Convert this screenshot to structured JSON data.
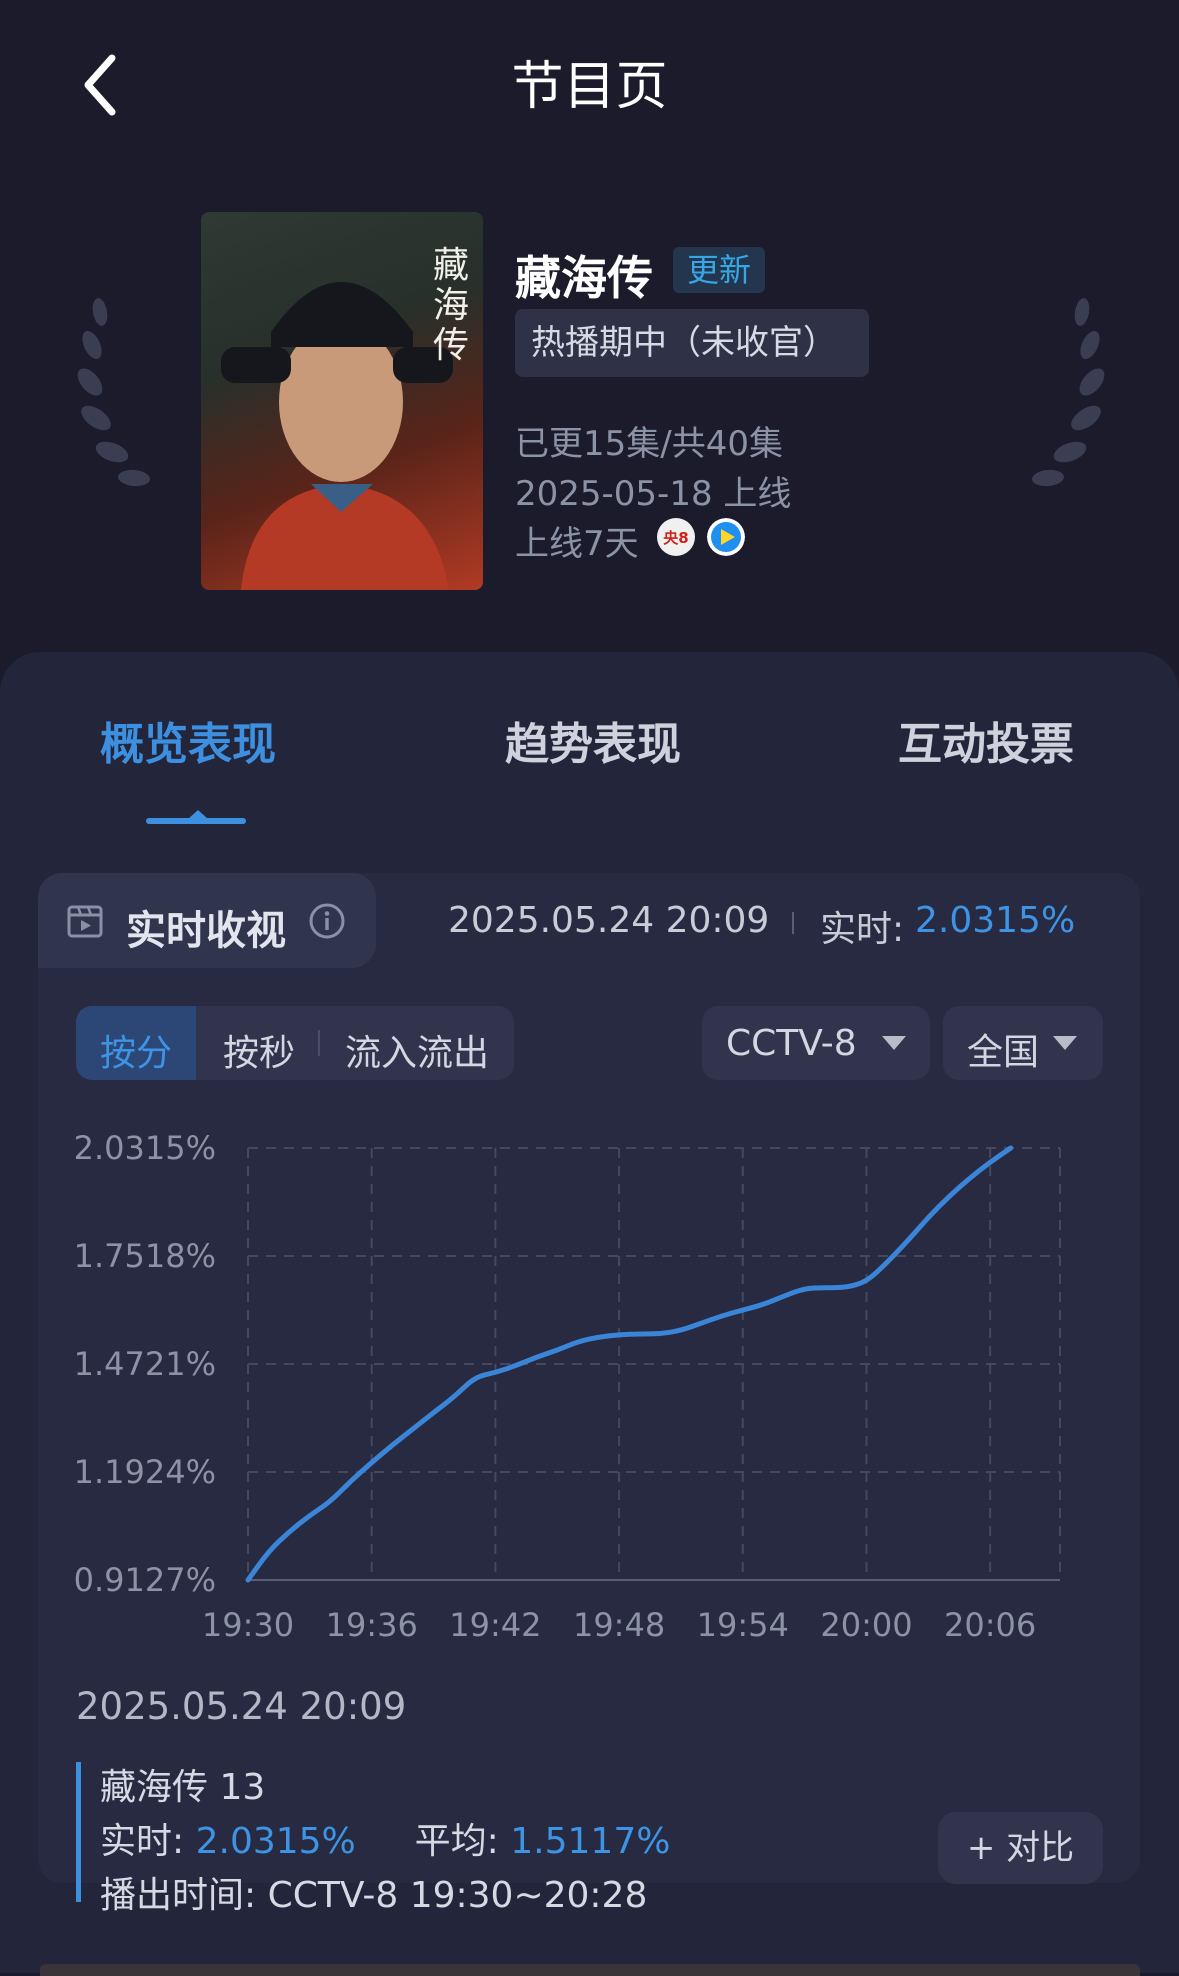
{
  "header": {
    "title": "节目页",
    "back_icon": "chevron-left-icon"
  },
  "show": {
    "title": "藏海传",
    "update_badge": "更新",
    "status": "热播期中（未收官）",
    "episodes": "已更15集/共40集",
    "release": "2025-05-18 上线",
    "days_online": "上线7天",
    "channel_icons": [
      "cctv8-icon",
      "play-platform-icon"
    ],
    "cctv8_icon_text": "央8",
    "poster_text": "藏海传"
  },
  "tabs": [
    {
      "label": "概览表现",
      "active": true
    },
    {
      "label": "趋势表现",
      "active": false
    },
    {
      "label": "互动投票",
      "active": false
    }
  ],
  "realtime": {
    "label": "实时收视",
    "timestamp": "2025.05.24 20:09",
    "rt_label": "实时:",
    "rt_value": "2.0315%"
  },
  "segments": [
    {
      "label": "按分",
      "active": true
    },
    {
      "label": "按秒",
      "active": false
    },
    {
      "label": "流入流出",
      "active": false
    }
  ],
  "filters": {
    "channel": "CCTV-8",
    "region": "全国"
  },
  "colors": {
    "accent": "#3e94e4",
    "background": "#1b1b2b",
    "card": "#23253a"
  },
  "chart_data": {
    "type": "line",
    "x_ticks": [
      "19:30",
      "19:36",
      "19:42",
      "19:48",
      "19:54",
      "20:00",
      "20:06"
    ],
    "y_ticks": [
      "0.9127%",
      "1.1924%",
      "1.4721%",
      "1.7518%",
      "2.0315%"
    ],
    "ylim": [
      0.9127,
      2.0315
    ],
    "xlim_minutes_from_start": [
      0,
      39
    ],
    "grid": true,
    "series": [
      {
        "x": [
          "19:30",
          "19:31",
          "19:32",
          "19:33",
          "19:34",
          "19:35",
          "19:36",
          "19:37",
          "19:38",
          "19:39",
          "19:40",
          "19:41",
          "19:42",
          "19:43",
          "19:44",
          "19:45",
          "19:46",
          "19:47",
          "19:48",
          "19:49",
          "19:50",
          "19:51",
          "19:52",
          "19:53",
          "19:54",
          "19:55",
          "19:56",
          "19:57",
          "19:58",
          "19:59",
          "20:00",
          "20:01",
          "20:02",
          "20:03",
          "20:04",
          "20:05",
          "20:06",
          "20:07",
          "20:08",
          "20:09"
        ],
        "values": [
          0.9127,
          0.987,
          1.038,
          1.08,
          1.116,
          1.17,
          1.217,
          1.262,
          1.304,
          1.346,
          1.387,
          1.438,
          1.45,
          1.468,
          1.49,
          1.508,
          1.53,
          1.542,
          1.548,
          1.55,
          1.55,
          1.559,
          1.578,
          1.597,
          1.612,
          1.626,
          1.648,
          1.668,
          1.67,
          1.67,
          1.685,
          1.735,
          1.791,
          1.852,
          1.906,
          1.953,
          1.995,
          2.0315,
          null,
          null
        ]
      }
    ]
  },
  "legend": {
    "timestamp": "2025.05.24 20:09",
    "episode": "藏海传 13",
    "rt_label": "实时:",
    "rt_value": "2.0315%",
    "avg_label": "平均:",
    "avg_value": "1.5117%",
    "air_time": "播出时间:  CCTV-8 19:30~20:28",
    "compare_button": "+ 对比"
  }
}
